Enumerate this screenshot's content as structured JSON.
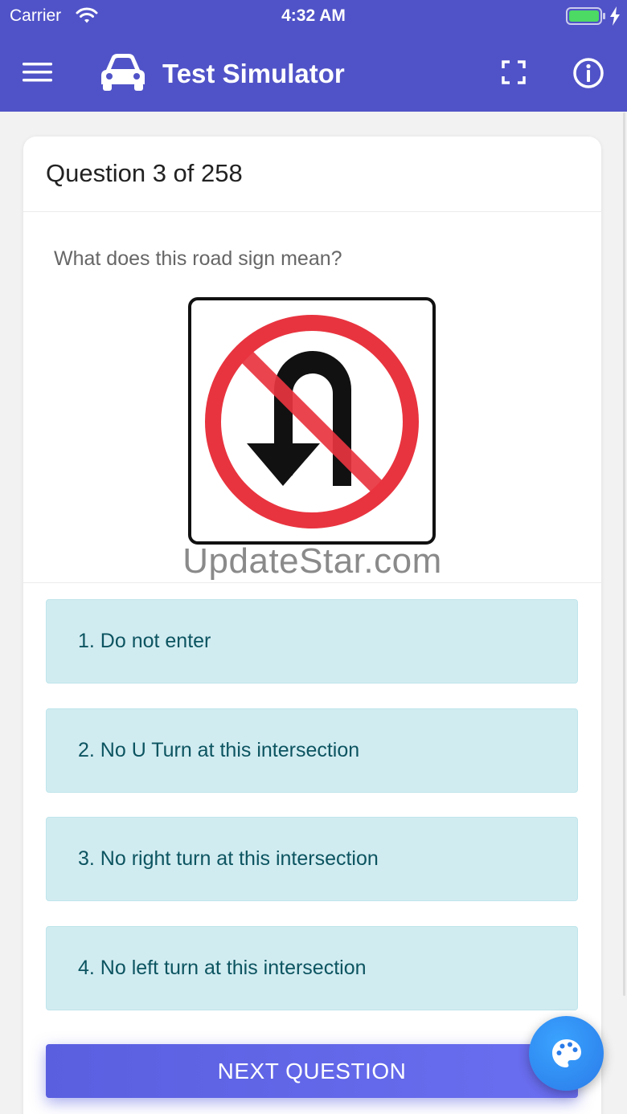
{
  "status_bar": {
    "carrier": "Carrier",
    "time": "4:32 AM"
  },
  "app_bar": {
    "title": "Test Simulator",
    "menu_icon": "hamburger-menu-icon",
    "logo_icon": "car-icon",
    "fullscreen_icon": "fullscreen-icon",
    "info_icon": "info-icon"
  },
  "question": {
    "counter": "Question 3 of 258",
    "text": "What does this road sign mean?",
    "sign_icon": "no-u-turn-sign",
    "watermark": "UpdateStar.com"
  },
  "answers": [
    {
      "label": "1. Do not enter"
    },
    {
      "label": "2. No U Turn at this intersection"
    },
    {
      "label": "3. No right turn at this intersection"
    },
    {
      "label": "4. No left turn at this intersection"
    }
  ],
  "next_button": {
    "label": "NEXT QUESTION"
  },
  "fab": {
    "icon": "palette-icon"
  },
  "colors": {
    "primary": "#5053c7",
    "answer_bg": "#d1ecf1",
    "answer_text": "#0c5460",
    "button": "#5a5fe0",
    "fab": "#2a7be8"
  }
}
